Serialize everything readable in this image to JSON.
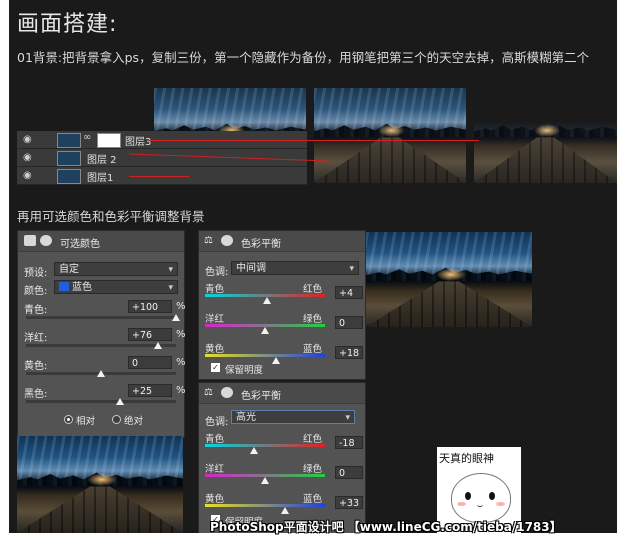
{
  "heading": "画面搭建:",
  "step1_text": "01背景:把背景拿入ps，复制三份，第一个隐藏作为备份，用钢笔把第三个的天空去掉，高斯模糊第二个",
  "step2_text": "再用可选颜色和色彩平衡调整背景",
  "layers": [
    {
      "name": "图层3",
      "has_mask": true
    },
    {
      "name": "图层 2",
      "has_mask": false
    },
    {
      "name": "图层1",
      "has_mask": false
    }
  ],
  "selective_color": {
    "title": "可选颜色",
    "preset_label": "预设:",
    "preset_value": "自定",
    "colors_label": "颜色:",
    "colors_value": "蓝色",
    "sliders": [
      {
        "label": "青色:",
        "value": "+100",
        "unit": "%",
        "fraction": 1.0
      },
      {
        "label": "洋红:",
        "value": "+76",
        "unit": "%",
        "fraction": 0.88
      },
      {
        "label": "黄色:",
        "value": "0",
        "unit": "%",
        "fraction": 0.5
      },
      {
        "label": "黑色:",
        "value": "+25",
        "unit": "%",
        "fraction": 0.625
      }
    ],
    "mode_relative": "相对",
    "mode_absolute": "绝对",
    "selected_mode": "相对"
  },
  "color_balance_1": {
    "title": "色彩平衡",
    "tone_label": "色调:",
    "tone_value": "中间调",
    "rows": [
      {
        "left": "青色",
        "right": "红色",
        "value": "+4",
        "fraction": 0.52
      },
      {
        "left": "洋红",
        "right": "绿色",
        "value": "0",
        "fraction": 0.5
      },
      {
        "left": "黄色",
        "right": "蓝色",
        "value": "+18",
        "fraction": 0.59
      }
    ],
    "preserve_label": "保留明度"
  },
  "color_balance_2": {
    "title": "色彩平衡",
    "tone_label": "色调:",
    "tone_value": "高光",
    "rows": [
      {
        "left": "青色",
        "right": "红色",
        "value": "-18",
        "fraction": 0.41
      },
      {
        "left": "洋红",
        "right": "绿色",
        "value": "0",
        "fraction": 0.5
      },
      {
        "left": "黄色",
        "right": "蓝色",
        "value": "+33",
        "fraction": 0.665
      }
    ],
    "preserve_label": "保留明度"
  },
  "sticker_text": "天真的眼神",
  "watermark": "PhotoShop平面设计吧 【www.lineCG.com/tieba/1783】",
  "colors": {
    "background": "#1a1a1a",
    "panel": "#535353",
    "annotation_line": "#d02020",
    "blue_swatch": "#1f5fe0"
  }
}
